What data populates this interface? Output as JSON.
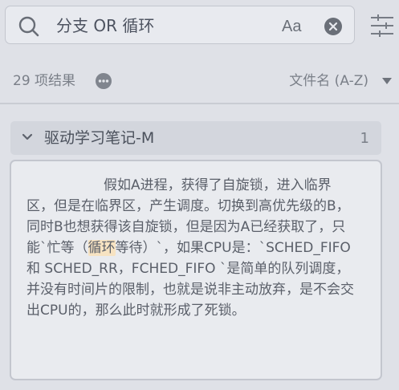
{
  "search": {
    "query": "分支 OR 循环",
    "case_label": "Aa"
  },
  "summary": {
    "count_text": "29 项结果",
    "sort_label": "文件名 (A-Z)"
  },
  "groups": [
    {
      "title": "驱动学习笔记-M",
      "count": "1",
      "expanded": true,
      "matches": [
        {
          "before": "假如A进程，获得了自旋锁，进入临界区，但是在临界区，产生调度。切换到高优先级的B，同时B也想获得该自旋锁，但是因为A已经获取了，只能`忙等（",
          "highlight": "循环",
          "after": "等待）`，如果CPU是：`SCHED_FIFO 和 SCHED_RR，FCHED_FIFO `是简单的队列调度，并没有时间片的限制，也就是说非主动放弃，是不会交出CPU的，那么此时就形成了死锁。"
        }
      ]
    }
  ],
  "icons": {
    "search": "search-icon",
    "clear": "clear-circle-x-icon",
    "filter": "filter-sliders-icon",
    "more": "more-dots-icon",
    "sort": "sort-down-arrow-icon",
    "expand": "chevron-down-icon"
  },
  "colors": {
    "background": "#dfe1e7",
    "highlight": "#f7e3c2",
    "text": "#5a5f69"
  }
}
